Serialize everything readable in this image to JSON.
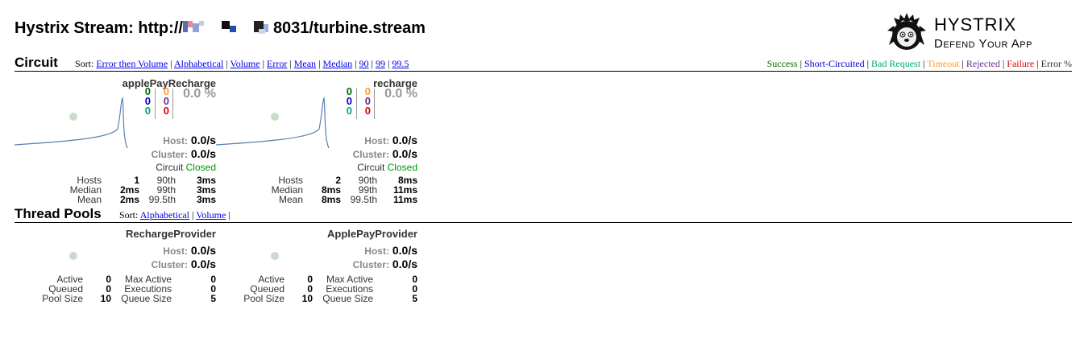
{
  "header": {
    "title_prefix": "Hystrix Stream: http://",
    "title_suffix": "8031/turbine.stream",
    "logo_title": "HYSTRIX",
    "logo_subtitle": "Defend Your App"
  },
  "circuit_section": {
    "title": "Circuit",
    "sort_label": "Sort:",
    "sort_options": [
      "Error then Volume",
      "Alphabetical",
      "Volume",
      "Error",
      "Mean",
      "Median",
      "90",
      "99",
      "99.5"
    ],
    "legend": [
      {
        "label": "Success",
        "color": "#006600"
      },
      {
        "label": "Short-Circuited",
        "color": "#0000cc"
      },
      {
        "label": "Bad Request",
        "color": "#00a870"
      },
      {
        "label": "Timeout",
        "color": "#ff9933"
      },
      {
        "label": "Rejected",
        "color": "#6a2c8f"
      },
      {
        "label": "Failure",
        "color": "#dd0000"
      },
      {
        "label": "Error %",
        "color": "#333333"
      }
    ],
    "circuits": [
      {
        "name": "applePayRecharge",
        "success": "0",
        "short_circuited": "0",
        "bad_request": "0",
        "timeout": "0",
        "rejected": "0",
        "failure": "0",
        "error_pct": "0.0 %",
        "host_label": "Host:",
        "host_rate": "0.0/s",
        "cluster_label": "Cluster:",
        "cluster_rate": "0.0/s",
        "circuit_label": "Circuit",
        "circuit_status": "Closed",
        "hosts_label": "Hosts",
        "hosts": "1",
        "median_label": "Median",
        "median": "2ms",
        "mean_label": "Mean",
        "mean": "2ms",
        "p90_label": "90th",
        "p90": "3ms",
        "p99_label": "99th",
        "p99": "3ms",
        "p995_label": "99.5th",
        "p995": "3ms"
      },
      {
        "name": "recharge",
        "success": "0",
        "short_circuited": "0",
        "bad_request": "0",
        "timeout": "0",
        "rejected": "0",
        "failure": "0",
        "error_pct": "0.0 %",
        "host_label": "Host:",
        "host_rate": "0.0/s",
        "cluster_label": "Cluster:",
        "cluster_rate": "0.0/s",
        "circuit_label": "Circuit",
        "circuit_status": "Closed",
        "hosts_label": "Hosts",
        "hosts": "2",
        "median_label": "Median",
        "median": "8ms",
        "mean_label": "Mean",
        "mean": "8ms",
        "p90_label": "90th",
        "p90": "8ms",
        "p99_label": "99th",
        "p99": "11ms",
        "p995_label": "99.5th",
        "p995": "11ms"
      }
    ]
  },
  "thread_section": {
    "title": "Thread Pools",
    "sort_label": "Sort:",
    "sort_options": [
      "Alphabetical",
      "Volume"
    ],
    "pools": [
      {
        "name": "RechargeProvider",
        "host_label": "Host:",
        "host_rate": "0.0/s",
        "cluster_label": "Cluster:",
        "cluster_rate": "0.0/s",
        "active_label": "Active",
        "active": "0",
        "queued_label": "Queued",
        "queued": "0",
        "pool_size_label": "Pool Size",
        "pool_size": "10",
        "max_active_label": "Max Active",
        "max_active": "0",
        "executions_label": "Executions",
        "executions": "0",
        "queue_size_label": "Queue Size",
        "queue_size": "5"
      },
      {
        "name": "ApplePayProvider",
        "host_label": "Host:",
        "host_rate": "0.0/s",
        "cluster_label": "Cluster:",
        "cluster_rate": "0.0/s",
        "active_label": "Active",
        "active": "0",
        "queued_label": "Queued",
        "queued": "0",
        "pool_size_label": "Pool Size",
        "pool_size": "10",
        "max_active_label": "Max Active",
        "max_active": "0",
        "executions_label": "Executions",
        "executions": "0",
        "queue_size_label": "Queue Size",
        "queue_size": "5"
      }
    ]
  }
}
